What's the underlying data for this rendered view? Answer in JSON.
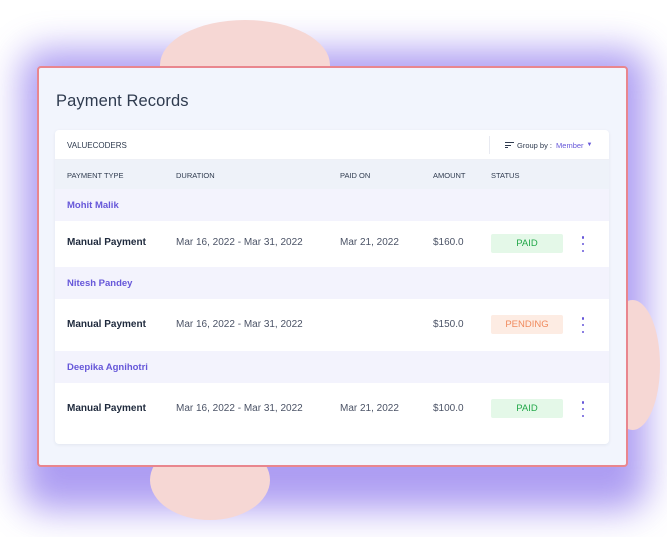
{
  "page": {
    "title": "Payment Records"
  },
  "toolbar": {
    "org_name": "VALUECODERS",
    "group_by_label": "Group by :",
    "group_by_value": "Member",
    "group_by_icon": "filter-lines-icon",
    "dropdown_icon": "caret-down-icon"
  },
  "table": {
    "columns": [
      "PAYMENT TYPE",
      "DURATION",
      "PAID ON",
      "AMOUNT",
      "STATUS"
    ],
    "groups": [
      {
        "member": "Mohit Malik",
        "row": {
          "payment_type": "Manual Payment",
          "duration": "Mar 16, 2022 - Mar 31, 2022",
          "paid_on": "Mar 21, 2022",
          "amount": "$160.0",
          "status": "PAID"
        }
      },
      {
        "member": "Nitesh Pandey",
        "row": {
          "payment_type": "Manual Payment",
          "duration": "Mar 16, 2022 - Mar 31, 2022",
          "paid_on": "",
          "amount": "$150.0",
          "status": "PENDING"
        }
      },
      {
        "member": "Deepika Agnihotri",
        "row": {
          "payment_type": "Manual Payment",
          "duration": "Mar 16, 2022 - Mar 31, 2022",
          "paid_on": "Mar 21, 2022",
          "amount": "$100.0",
          "status": "PAID"
        }
      }
    ]
  },
  "colors": {
    "accent": "#6657d9",
    "paid_text": "#23a84a",
    "paid_bg": "#e4f8e8",
    "pending_text": "#f08a5d",
    "pending_bg": "#fdece3",
    "panel_border": "#e9868e"
  }
}
